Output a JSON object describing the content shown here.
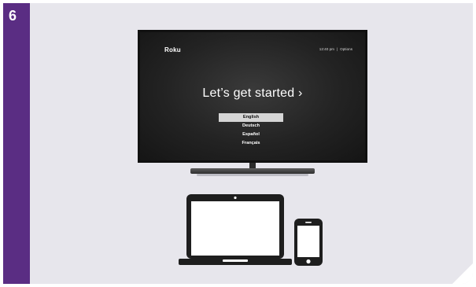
{
  "step": {
    "number": "6"
  },
  "tv": {
    "brand": "Roku",
    "time": "12:40 pm",
    "separator": "|",
    "options_label": "Options",
    "headline": "Let’s get started ›",
    "languages": [
      {
        "label": "English",
        "selected": true
      },
      {
        "label": "Deutsch",
        "selected": false
      },
      {
        "label": "Español",
        "selected": false
      },
      {
        "label": "Français",
        "selected": false
      }
    ]
  },
  "icons": {
    "laptop": "laptop-icon",
    "phone": "smartphone-icon"
  },
  "colors": {
    "step_bar": "#5a2d83",
    "panel_background": "#e7e6ec",
    "selected_item": "#d5d5d5"
  }
}
